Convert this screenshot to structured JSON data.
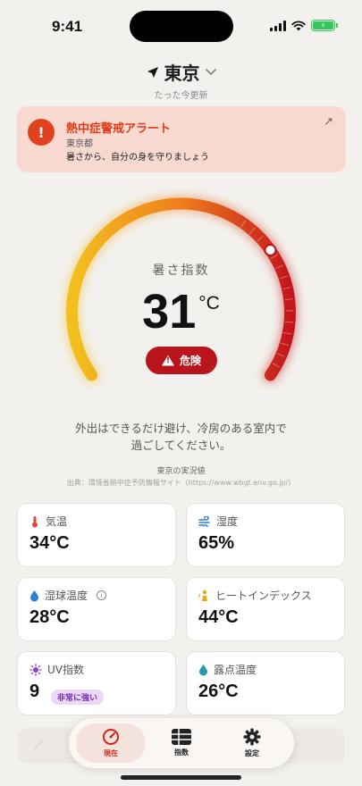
{
  "status": {
    "time": "9:41"
  },
  "header": {
    "location": "東京",
    "updated": "たった今更新"
  },
  "alert": {
    "title": "熱中症警戒アラート",
    "region": "東京都",
    "message": "暑さから、自分の身を守りましょう"
  },
  "gauge": {
    "label": "暑さ指数",
    "value": "31",
    "unit": "°C",
    "level": "危険",
    "fraction": 0.72,
    "colors": {
      "start": "#f2c01e",
      "mid": "#f07d1c",
      "end": "#c2161c",
      "track": "#d9d6d1"
    }
  },
  "advice": {
    "line1": "外出はできるだけ避け、冷房のある室内で",
    "line2": "過ごしてください。"
  },
  "source": {
    "title": "東京の実況値",
    "url": "出典：環境省熱中症予防情報サイト（https://www.wbgt.env.go.jp/）"
  },
  "cards": {
    "temperature": {
      "label": "気温",
      "value": "34°C",
      "icon": "thermometer-icon"
    },
    "humidity": {
      "label": "湿度",
      "value": "65%",
      "icon": "wind-icon"
    },
    "wet_bulb": {
      "label": "湿球温度",
      "value": "28°C",
      "icon": "droplet-icon"
    },
    "heat_index": {
      "label": "ヒートインデックス",
      "value": "44°C",
      "icon": "heat-person-icon"
    },
    "uv": {
      "label": "UV指数",
      "value": "9",
      "badge": "非常に強い",
      "icon": "sun-icon"
    },
    "dew_point": {
      "label": "露点温度",
      "value": "26°C",
      "icon": "dew-drop-icon"
    }
  },
  "tabs": {
    "current": "現在",
    "index": "指数",
    "settings": "設定"
  }
}
